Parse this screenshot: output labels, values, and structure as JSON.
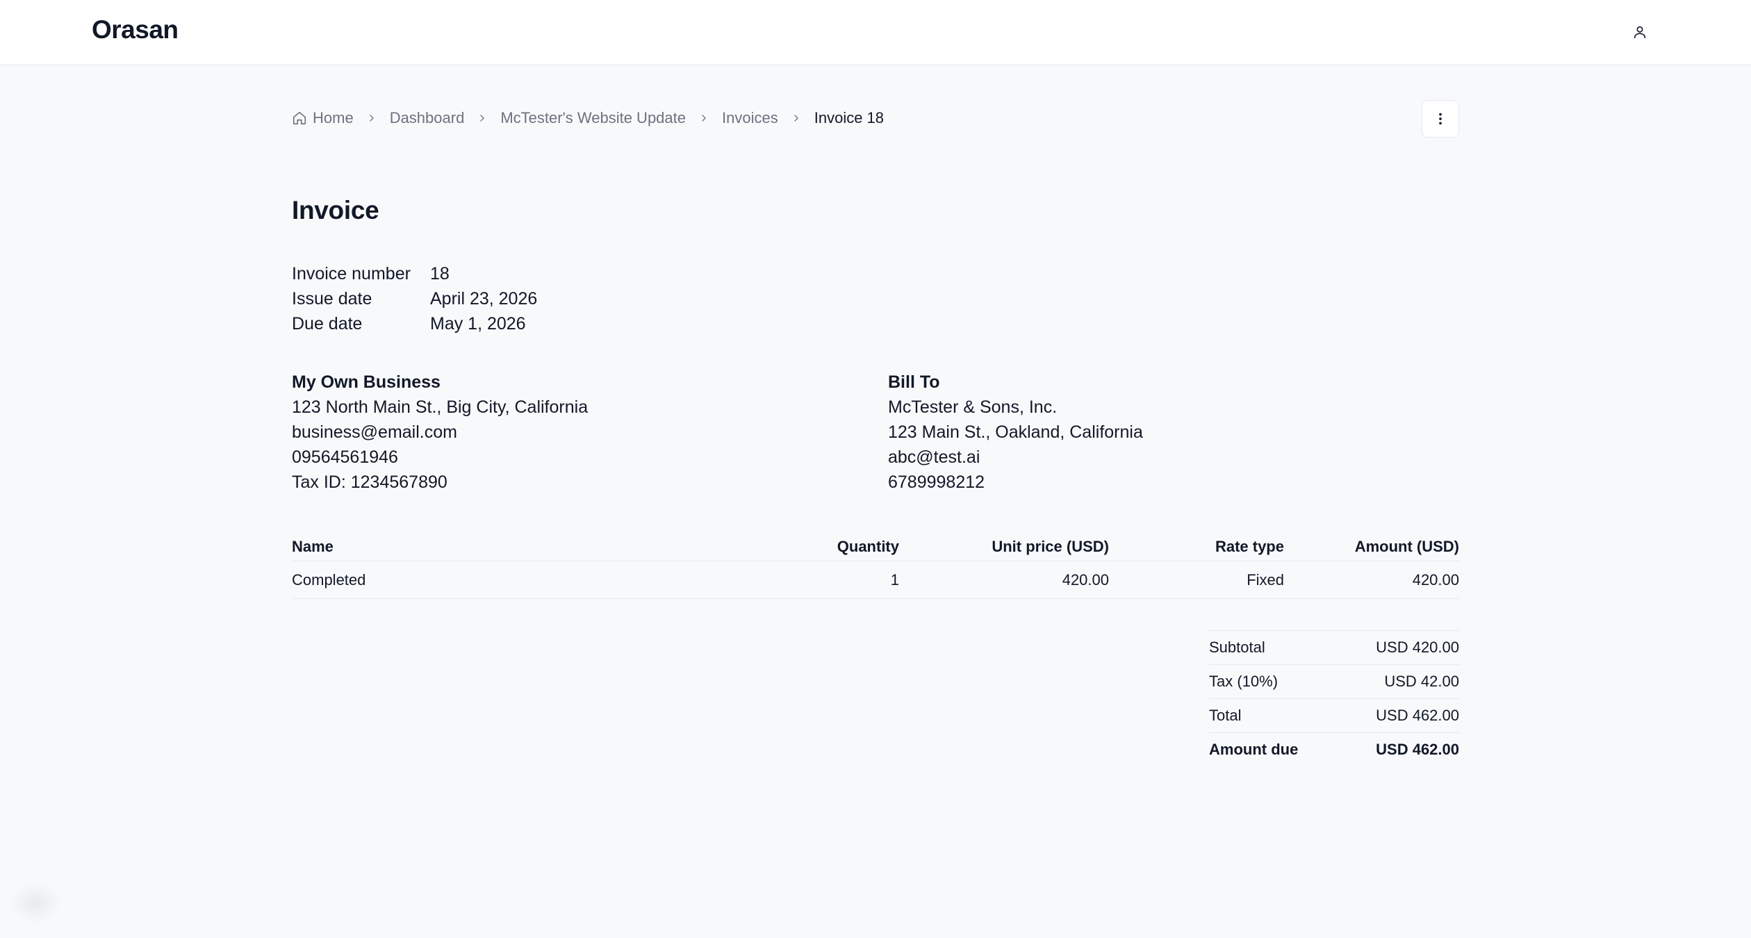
{
  "app": {
    "name": "Orasan"
  },
  "icons": {
    "user": "user-icon",
    "home": "home-icon",
    "chevron": "chevron-right-icon",
    "more": "more-vertical-icon"
  },
  "breadcrumb": {
    "items": [
      {
        "label": "Home"
      },
      {
        "label": "Dashboard"
      },
      {
        "label": "McTester's Website Update"
      },
      {
        "label": "Invoices"
      },
      {
        "label": "Invoice 18"
      }
    ]
  },
  "invoice": {
    "title": "Invoice",
    "meta": [
      {
        "label": "Invoice number",
        "value": "18"
      },
      {
        "label": "Issue date",
        "value": "April 23, 2026"
      },
      {
        "label": "Due date",
        "value": "May 1, 2026"
      }
    ],
    "from": {
      "name": "My Own Business",
      "address": "123 North Main St., Big City, California",
      "email": "business@email.com",
      "phone": "09564561946",
      "tax_id": "Tax ID: 1234567890"
    },
    "bill_to": {
      "heading": "Bill To",
      "name": "McTester & Sons, Inc.",
      "address": "123 Main St., Oakland, California",
      "email": "abc@test.ai",
      "phone": "6789998212"
    },
    "table": {
      "headers": {
        "name": "Name",
        "quantity": "Quantity",
        "unit_price": "Unit price (USD)",
        "rate_type": "Rate type",
        "amount": "Amount (USD)"
      },
      "rows": [
        {
          "name": "Completed",
          "quantity": "1",
          "unit_price": "420.00",
          "rate_type": "Fixed",
          "amount": "420.00"
        }
      ]
    },
    "totals": [
      {
        "label": "Subtotal",
        "value": "USD 420.00"
      },
      {
        "label": "Tax (10%)",
        "value": "USD 42.00"
      },
      {
        "label": "Total",
        "value": "USD 462.00"
      },
      {
        "label": "Amount due",
        "value": "USD 462.00"
      }
    ]
  }
}
